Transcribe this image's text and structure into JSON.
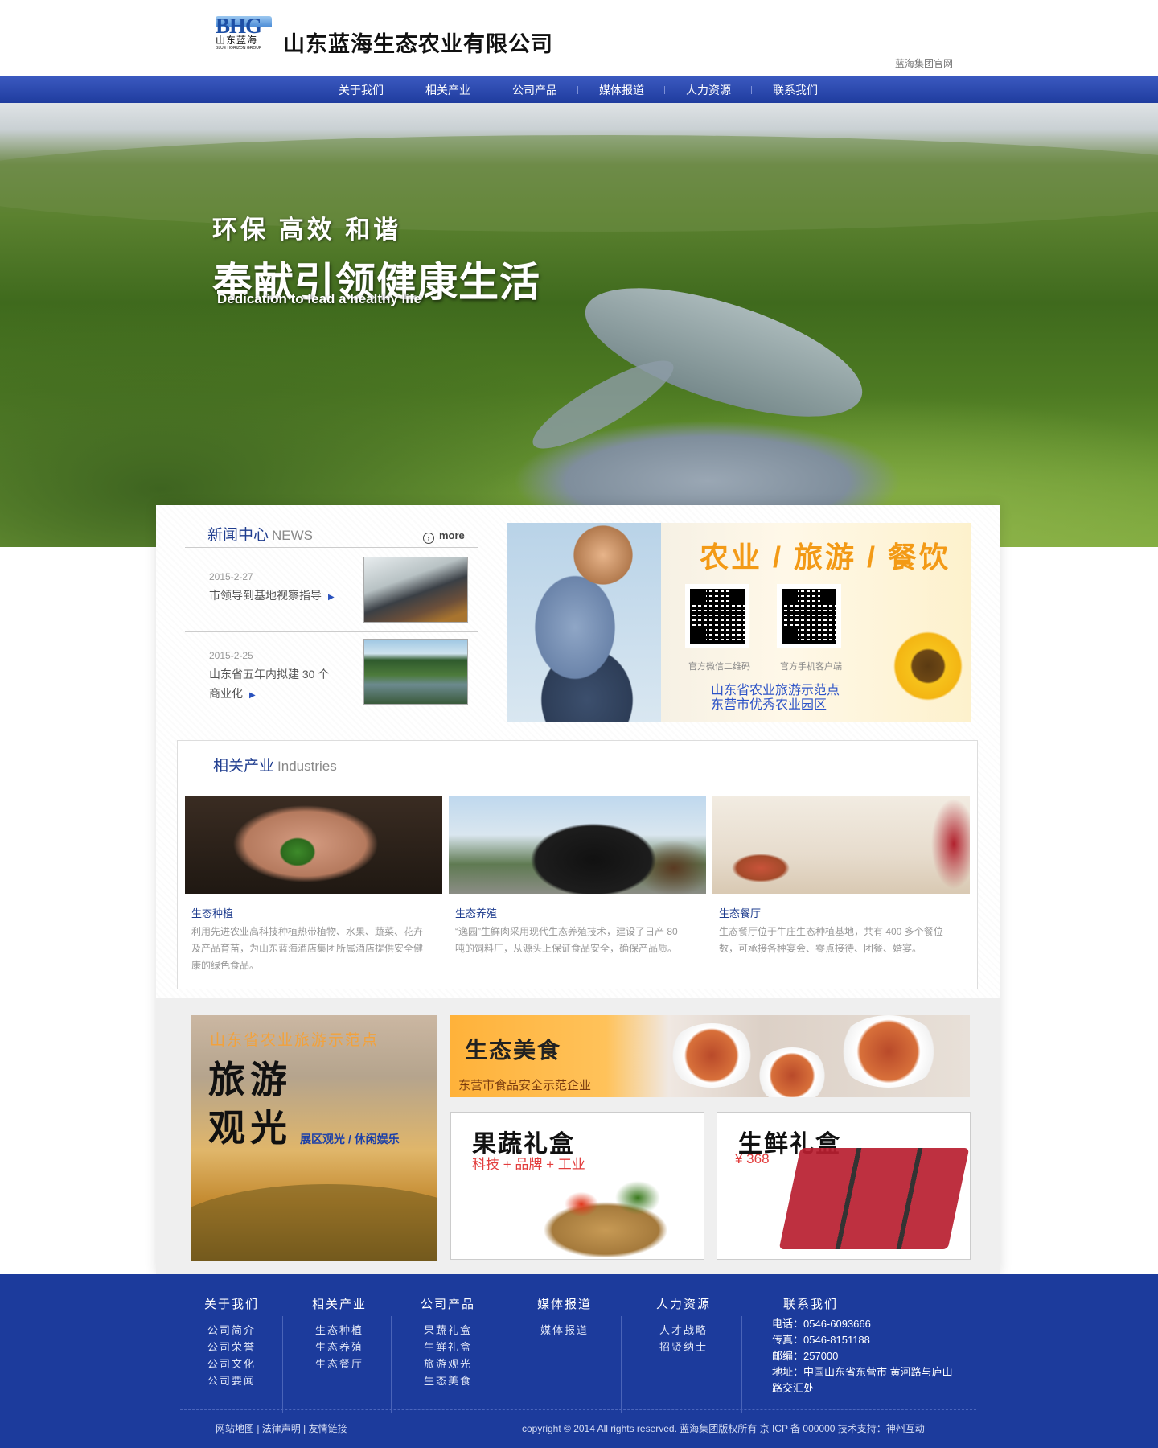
{
  "header": {
    "company_name": "山东蓝海生态农业有限公司",
    "logo_letters": "BHG",
    "logo_cn": "山东蓝海",
    "logo_en": "BLUE HORIZON GROUP",
    "group_link": "蓝海集团官网"
  },
  "nav": {
    "items": [
      {
        "label": "关于我们"
      },
      {
        "label": "相关产业"
      },
      {
        "label": "公司产品"
      },
      {
        "label": "媒体报道"
      },
      {
        "label": "人力资源"
      },
      {
        "label": "联系我们"
      }
    ]
  },
  "banner": {
    "line1": "环保  高效  和谐",
    "line2": "奉献引领健康生活",
    "line3": "Dedication to lead a healthy life"
  },
  "news": {
    "title": "新闻中心",
    "title_en": "NEWS",
    "more": "more",
    "items": [
      {
        "date": "2015-2-27",
        "text": "市领导到基地视察指导"
      },
      {
        "date": "2015-2-25",
        "text": "山东省五年内拟建 30 个商业化"
      }
    ]
  },
  "promo": {
    "title": "农业 / 旅游 / 餐饮",
    "qr1_caption": "官方微信二维码",
    "qr2_caption": "官方手机客户端",
    "sub1": "山东省农业旅游示范点",
    "sub2": "东营市优秀农业园区"
  },
  "industries": {
    "title": "相关产业",
    "title_en": "Industries",
    "items": [
      {
        "name": "生态种植",
        "desc": "利用先进农业高科技种植热带植物、水果、蔬菜、花卉及产品育苗，为山东蓝海酒店集团所属酒店提供安全健康的绿色食品。"
      },
      {
        "name": "生态养殖",
        "desc": "“逸园”生鲜肉采用现代生态养殖技术，建设了日产 80 吨的饲料厂，从源头上保证食品安全，确保产品质。"
      },
      {
        "name": "生态餐厅",
        "desc": "生态餐厅位于牛庄生态种植基地，共有 400 多个餐位数，可承接各种宴会、零点接待、团餐、婚宴。"
      }
    ]
  },
  "tour": {
    "t1": "山东省农业旅游示范点",
    "t2a": "旅游",
    "t2b": "观光",
    "t3": "展区观光 / 休闲娱乐"
  },
  "food": {
    "t1": "生态美食",
    "t2": "东营市食品安全示范企业"
  },
  "gift_veg": {
    "t1": "果蔬礼盒",
    "t2": "科技 + 品牌 + 工业"
  },
  "gift_meat": {
    "t1": "生鲜礼盒",
    "t2": "¥ 368"
  },
  "footer": {
    "cols": [
      {
        "head": "关于我们",
        "links": [
          "公司简介",
          "公司荣誉",
          "公司文化",
          "公司要闻"
        ]
      },
      {
        "head": "相关产业",
        "links": [
          "生态种植",
          "生态养殖",
          "生态餐厅"
        ]
      },
      {
        "head": "公司产品",
        "links": [
          "果蔬礼盒",
          "生鲜礼盒",
          "旅游观光",
          "生态美食"
        ]
      },
      {
        "head": "媒体报道",
        "links": [
          "媒体报道"
        ]
      },
      {
        "head": "人力资源",
        "links": [
          "人才战略",
          "招贤纳士"
        ]
      }
    ],
    "contact_head": "联系我们",
    "phone": "电话：0546-6093666",
    "fax": "传真：0546-8151188",
    "zip": "邮编：257000",
    "address": "地址：中国山东省东营市   黄河路与庐山路交汇处",
    "bottom_left": "网站地图 | 法律声明 | 友情链接",
    "copyright": "copyright © 2014 All rights reserved. 蓝海集团版权所有 京 ICP 备 000000 技术支持：神州互动"
  }
}
